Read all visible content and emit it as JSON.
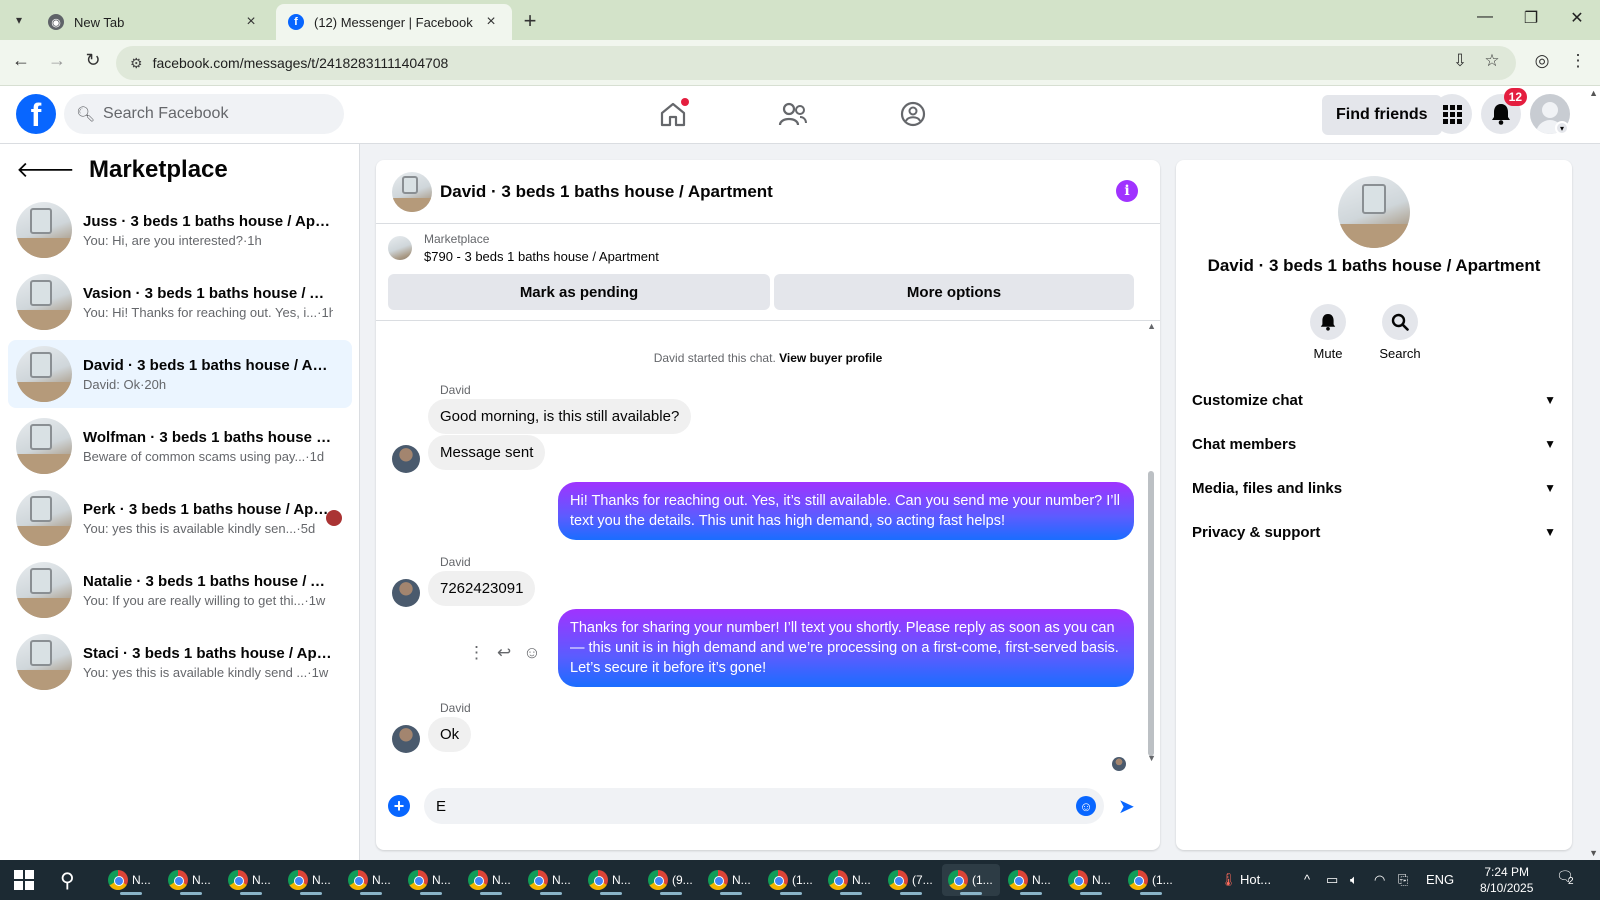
{
  "browser": {
    "tabs": [
      {
        "title": "New Tab",
        "active": false
      },
      {
        "title": "(12) Messenger | Facebook",
        "active": true
      }
    ],
    "url": "facebook.com/messages/t/24182831111404708"
  },
  "fb_header": {
    "search_placeholder": "Search Facebook",
    "find_friends": "Find friends",
    "notification_count": "12"
  },
  "sidebar": {
    "title": "Marketplace",
    "conversations": [
      {
        "name": "Juss · 3 beds 1 baths house / Apartment",
        "snippet": "You: Hi, are you interested?·1h"
      },
      {
        "name": "Vasion · 3 beds 1 baths house / Apartment",
        "snippet": "You: Hi! Thanks for reaching out. Yes, i...·1h"
      },
      {
        "name": "David · 3 beds 1 baths house / Apartment",
        "snippet": "David: Ok·20h"
      },
      {
        "name": "Wolfman · 3 beds 1 baths house / Apartment",
        "snippet": "Beware of common scams using pay...·1d"
      },
      {
        "name": "Perk · 3 beds 1 baths house / Apartment",
        "snippet": "You: yes this is available kindly sen...·5d"
      },
      {
        "name": "Natalie · 3 beds 1 baths house / Apartment",
        "snippet": "You: If you are really willing to get thi...·1w"
      },
      {
        "name": "Staci · 3 beds 1 baths house / Apartment",
        "snippet": "You: yes this is available kindly send ...·1w"
      }
    ]
  },
  "chat": {
    "title": "David · 3 beds 1 baths house / Apartment",
    "listing_label": "Marketplace",
    "listing_price": "$790 - 3 beds 1 baths house / Apartment",
    "mark_pending": "Mark as pending",
    "more_options": "More options",
    "system_note_prefix": "David started this chat.",
    "system_note_link": "View buyer profile",
    "messages": [
      {
        "from": "David",
        "text": "Good morning, is this still available?"
      },
      {
        "from": "David",
        "text": "Message sent"
      },
      {
        "from": "me",
        "text": "Hi! Thanks for reaching out. Yes, it’s still available. Can you send me your number? I’ll text you the details. This unit has high demand, so acting fast helps!"
      },
      {
        "from": "David",
        "text": "7262423091"
      },
      {
        "from": "me",
        "text": "Thanks for sharing your number! I’ll text you shortly. Please reply as soon as you can — this unit is in high demand and we’re processing on a first-come, first-served basis. Let’s secure it before it’s gone!"
      },
      {
        "from": "David",
        "text": "Ok"
      }
    ],
    "sender_label": "David",
    "composer_value": "E"
  },
  "info_panel": {
    "name": "David · 3 beds 1 baths house / Apartment",
    "mute": "Mute",
    "search": "Search",
    "sections": [
      "Customize chat",
      "Chat members",
      "Media, files and links",
      "Privacy & support"
    ]
  },
  "taskbar": {
    "apps": [
      "N...",
      "N...",
      "N...",
      "N...",
      "N...",
      "N...",
      "N...",
      "N...",
      "N...",
      "(9...",
      "N...",
      "(1...",
      "N...",
      "(7...",
      "(1...",
      "N...",
      "N...",
      "(1..."
    ],
    "weather": "Hot...",
    "lang": "ENG",
    "time": "7:24 PM",
    "date": "8/10/2025",
    "notif_count": "2"
  },
  "colors": {
    "fb_blue": "#0866ff",
    "bubble_gradient_top": "#a033ff",
    "bubble_gradient_bottom": "#1a6dff",
    "selected_conv": "#ebf5ff",
    "badge_red": "#e41e3f"
  }
}
